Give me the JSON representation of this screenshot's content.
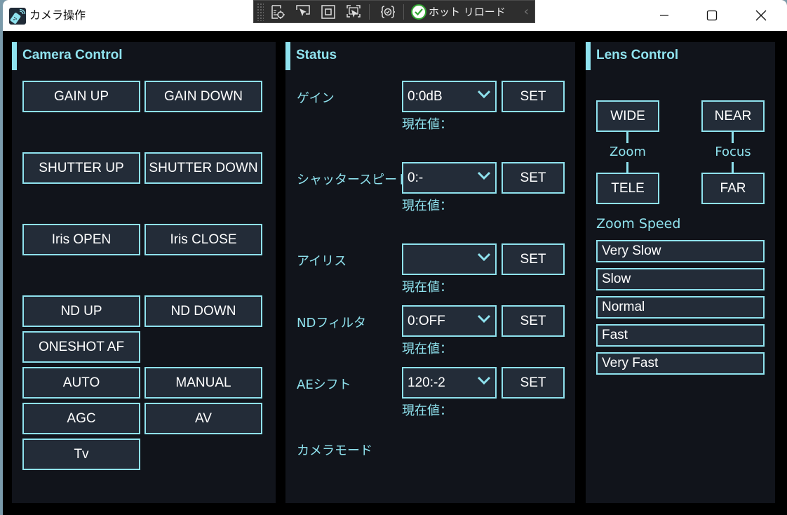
{
  "window": {
    "title": "カメラ操作",
    "controls": {
      "minimize": "minimize-icon",
      "maximize": "maximize-icon",
      "close": "close-icon"
    }
  },
  "devtoolbar": {
    "icons": [
      "live-visual-tree-icon",
      "select-element-icon",
      "display-layout-adorners-icon",
      "track-focus-icon",
      "binding-failures-icon"
    ],
    "hot_reload_label": "ホット リロード",
    "collapse_icon": "chevron-left-icon"
  },
  "camera_control": {
    "title": "Camera Control",
    "buttons": {
      "gain_up": "GAIN UP",
      "gain_down": "GAIN DOWN",
      "shutter_up": "SHUTTER UP",
      "shutter_down": "SHUTTER DOWN",
      "iris_open": "Iris OPEN",
      "iris_close": "Iris CLOSE",
      "nd_up": "ND UP",
      "nd_down": "ND DOWN",
      "oneshot_af": "ONESHOT AF",
      "auto": "AUTO",
      "manual": "MANUAL",
      "agc": "AGC",
      "av": "AV",
      "tv": "Tv"
    }
  },
  "status": {
    "title": "Status",
    "rows": [
      {
        "label": "ゲイン",
        "value": "0:0dB",
        "set": "SET",
        "current": "現在値："
      },
      {
        "label": "シャッタースピード",
        "value": "0:-",
        "set": "SET",
        "current": "現在値："
      },
      {
        "label": "アイリス",
        "value": "",
        "set": "SET",
        "current": "現在値："
      },
      {
        "label": "NDフィルタ",
        "value": "0:OFF",
        "set": "SET",
        "current": "現在値："
      },
      {
        "label": "AEシフト",
        "value": "120:-2",
        "set": "SET",
        "current": "現在値："
      }
    ],
    "camera_mode_label": "カメラモード"
  },
  "lens_control": {
    "title": "Lens Control",
    "zoom": {
      "label": "Zoom",
      "wide": "WIDE",
      "tele": "TELE"
    },
    "focus": {
      "label": "Focus",
      "near": "NEAR",
      "far": "FAR"
    },
    "zoom_speed": {
      "label": "Zoom Speed",
      "options": [
        "Very Slow",
        "Slow",
        "Normal",
        "Fast",
        "Very Fast"
      ]
    }
  },
  "colors": {
    "accent": "#8fe2ee",
    "panel_bg": "#11141b",
    "button_bg": "#232c38",
    "window_bg": "#000000"
  }
}
